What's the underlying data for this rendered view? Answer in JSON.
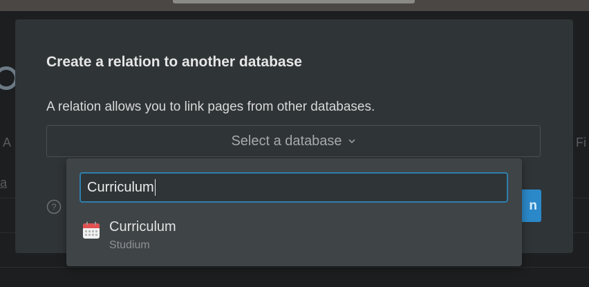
{
  "background": {
    "left_fragment_1": "A",
    "left_fragment_2": "a",
    "right_fragment": "Fi"
  },
  "modal": {
    "title": "Create a relation to another database",
    "description": "A relation allows you to link pages from other databases.",
    "select_placeholder": "Select a database",
    "create_button_label": "n",
    "help_icon": "question-circle-icon"
  },
  "dropdown": {
    "search_value": "Curriculum",
    "results": [
      {
        "title": "Curriculum",
        "subtitle": "Studium",
        "icon": "calendar-icon"
      }
    ]
  },
  "colors": {
    "accent": "#2b88c9",
    "modal_bg": "#2f3437",
    "dropdown_bg": "#3f4447",
    "focus_ring": "#2f7fae"
  }
}
